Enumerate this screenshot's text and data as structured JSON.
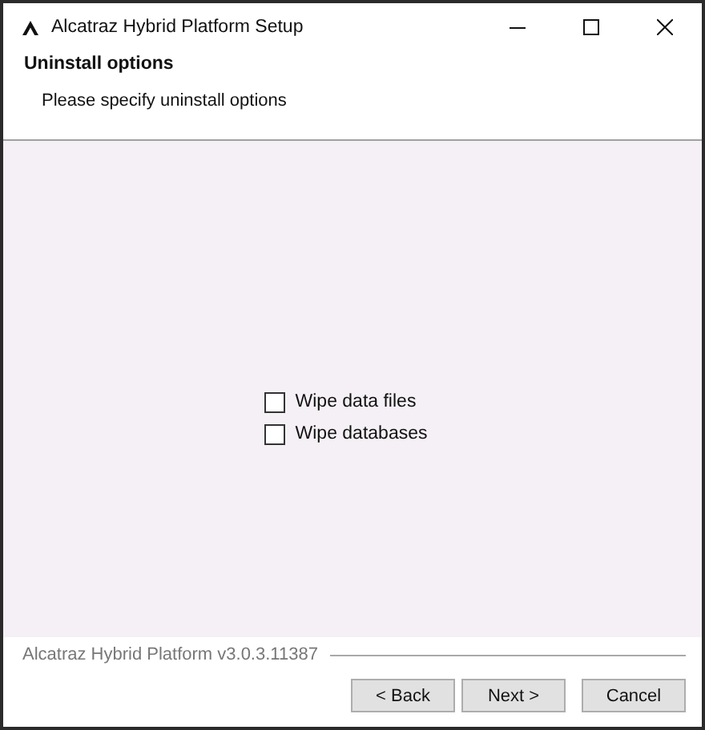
{
  "window": {
    "title": "Alcatraz Hybrid Platform Setup"
  },
  "header": {
    "title": "Uninstall options",
    "subtitle": "Please specify uninstall options"
  },
  "options": [
    {
      "label": "Wipe data files",
      "checked": false
    },
    {
      "label": "Wipe databases",
      "checked": false
    }
  ],
  "footer": {
    "version": "Alcatraz Hybrid Platform v3.0.3.11387"
  },
  "buttons": [
    "< Back",
    "Next >",
    "Cancel"
  ]
}
